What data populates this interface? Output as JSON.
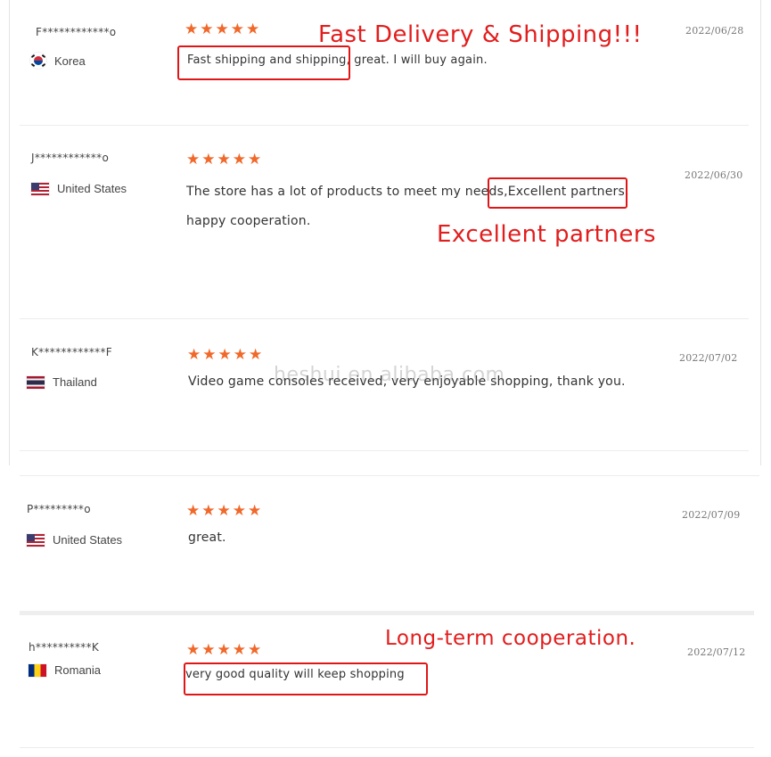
{
  "watermark": "heshui.en.alibaba.com",
  "reviews": [
    {
      "name": "F************o",
      "country": "Korea",
      "flag": "korea-flag-icon",
      "rating": 5,
      "date": "2022/06/28",
      "text_line1": "Fast shipping and shipping, great. I will buy again.",
      "annotation": "Fast Delivery &  Shipping!!!"
    },
    {
      "name": "J************o",
      "country": "United States",
      "flag": "us-flag-icon",
      "rating": 5,
      "date": "2022/06/30",
      "text_line1": "The store has a lot of products to meet my needs,Excellent partners,",
      "text_line2": "happy cooperation.",
      "annotation": "Excellent partners"
    },
    {
      "name": "K************F",
      "country": "Thailand",
      "flag": "thailand-flag-icon",
      "rating": 5,
      "date": "2022/07/02",
      "text_line1": "Video game consoles received, very enjoyable shopping, thank you."
    },
    {
      "name": "P*********o",
      "country": "United States",
      "flag": "us-flag-icon",
      "rating": 5,
      "date": "2022/07/09",
      "text_line1": "great."
    },
    {
      "name": "h**********K",
      "country": "Romania",
      "flag": "romania-flag-icon",
      "rating": 5,
      "date": "2022/07/12",
      "text_line1": "very good quality will keep shopping",
      "annotation": "Long-term cooperation."
    }
  ],
  "star_glyph": "★",
  "colors": {
    "star": "#f0682a",
    "annotation": "#e21d1d",
    "highlight_box": "#e01616"
  }
}
